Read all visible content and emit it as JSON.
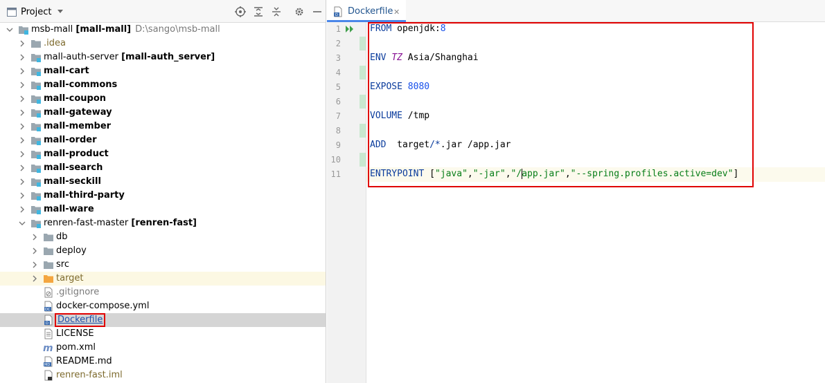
{
  "panel": {
    "title": "Project",
    "icons": [
      "locate-icon",
      "expand-all-icon",
      "collapse-all-icon",
      "gear-icon",
      "minimize-icon"
    ]
  },
  "tree": {
    "root": {
      "name": "msb-mall",
      "module": "[mall-mall]",
      "path": "D:\\sango\\msb-mall"
    },
    "idea": ".idea",
    "auth": {
      "name": "mall-auth-server",
      "module": "[mall-auth_server]"
    },
    "modules": [
      "mall-cart",
      "mall-commons",
      "mall-coupon",
      "mall-gateway",
      "mall-member",
      "mall-order",
      "mall-product",
      "mall-search",
      "mall-seckill",
      "mall-third-party",
      "mall-ware"
    ],
    "renren": {
      "name": "renren-fast-master",
      "module": "[renren-fast]"
    },
    "folders": [
      "db",
      "deploy",
      "src"
    ],
    "target": "target",
    "files": [
      ".gitignore",
      "docker-compose.yml",
      "Dockerfile",
      "LICENSE",
      "pom.xml",
      "README.md",
      "renren-fast.iml"
    ]
  },
  "editor": {
    "tab": "Dockerfile",
    "line_numbers": [
      "1",
      "2",
      "3",
      "4",
      "5",
      "6",
      "7",
      "8",
      "9",
      "10",
      "11"
    ],
    "code": {
      "l1_kw": "FROM",
      "l1_img": "openjdk:",
      "l1_ver": "8",
      "l3_kw": "ENV",
      "l3_var": "TZ",
      "l3_val": "Asia/Shanghai",
      "l5_kw": "EXPOSE",
      "l5_port": "8080",
      "l7_kw": "VOLUME",
      "l7_val": "/tmp",
      "l9_kw": "ADD",
      "l9_a": "target",
      "l9_b": "/*",
      "l9_c": ".jar /app.jar",
      "l11_kw": "ENTRYPOINT",
      "l11_open": "[",
      "l11_s1": "\"java\"",
      "l11_s2": "\"-jar\"",
      "l11_s3a": "\"/",
      "l11_s3b": "app.jar\"",
      "l11_s4": "\"--spring.profiles.active=dev\"",
      "l11_close": "]",
      "comma": ","
    }
  },
  "colors": {
    "keyword": "#0a3b9c",
    "string": "#067d17",
    "number": "#1750eb",
    "highlight": "#e00000",
    "selection": "#d5d5d5"
  }
}
